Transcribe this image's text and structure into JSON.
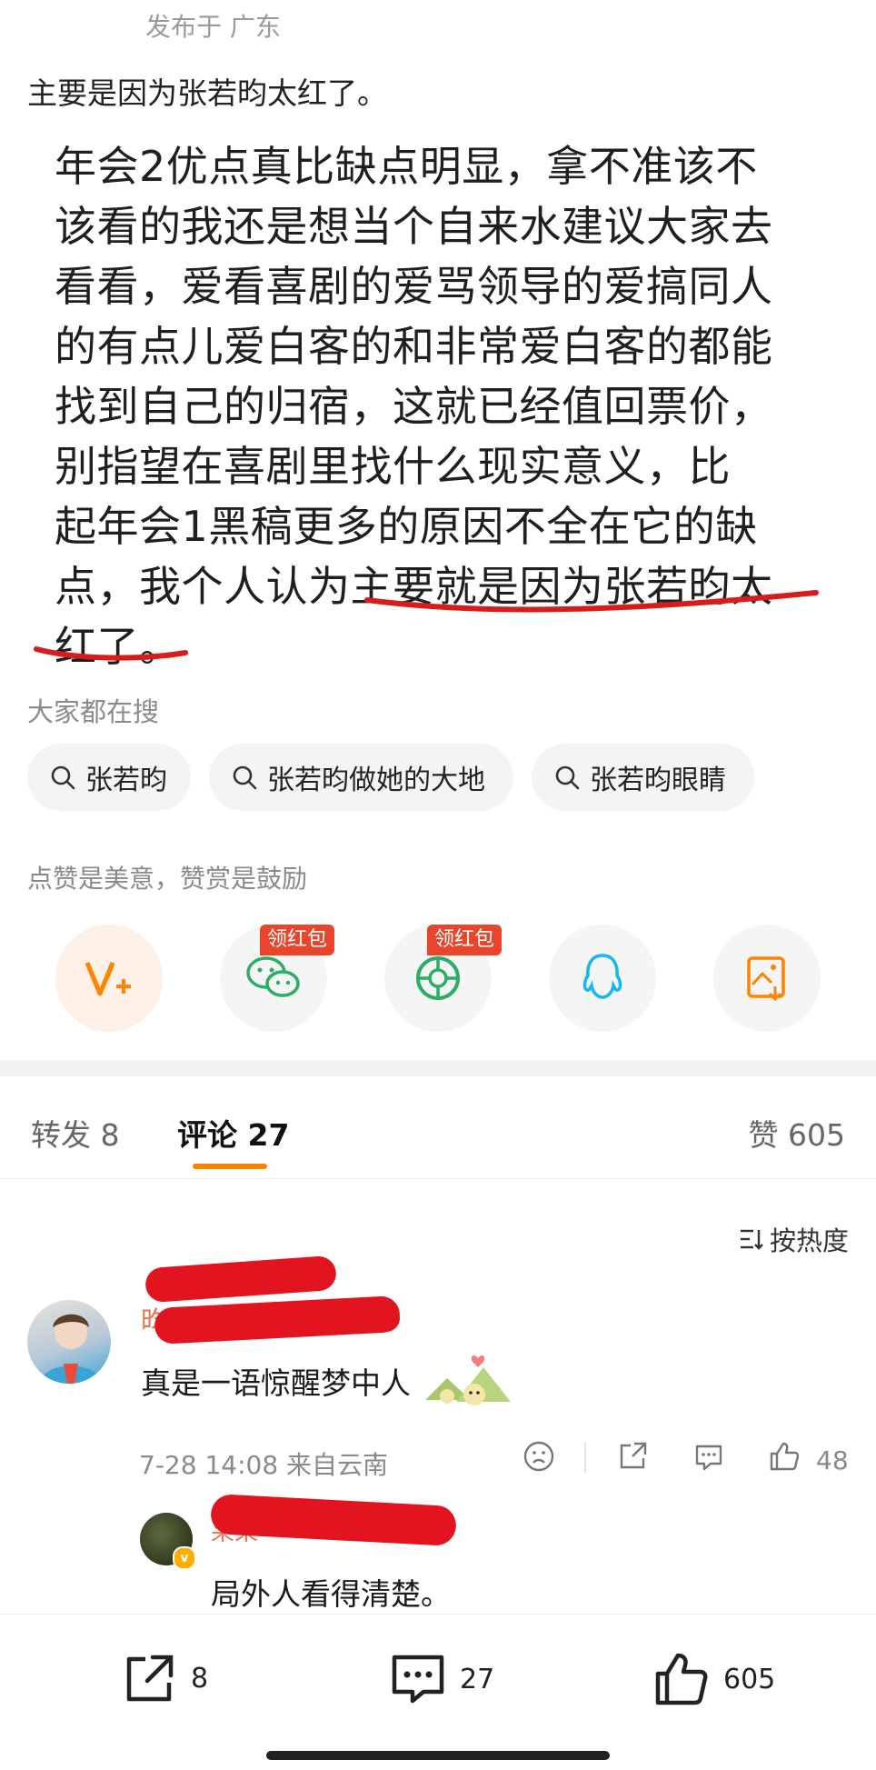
{
  "post": {
    "location_line": "发布于 广东",
    "text": "主要是因为张若昀太红了。"
  },
  "quote_image": {
    "lines": [
      "年会2优点真比缺点明显，拿不准该不",
      "该看的我还是想当个自来水建议大家去",
      "看看，爱看喜剧的爱骂领导的爱搞同人",
      "的有点儿爱白客的和非常爱白客的都能",
      "找到自己的归宿，这就已经值回票价，",
      "别指望在喜剧里找什么现实意义，比",
      "起年会1黑稿更多的原因不全在它的缺",
      "点，我个人认为主要就是因为张若昀太",
      "红了。"
    ]
  },
  "search": {
    "title": "大家都在搜",
    "chips": [
      "张若昀",
      "张若昀做她的大地",
      "张若昀眼睛"
    ]
  },
  "reward": {
    "hint": "点赞是美意，赞赏是鼓励",
    "badge_label": "领红包",
    "icons": [
      "v-plus-icon",
      "wechat-icon",
      "moments-icon",
      "qq-icon",
      "save-image-icon"
    ],
    "accent": "#ff8200"
  },
  "tabs": {
    "repost": "转发 8",
    "comments": "评论 27",
    "likes": "赞 605"
  },
  "sort_label": "按热度",
  "comments": [
    {
      "name_visible": "昀汐",
      "text": "真是一语惊醒梦中人",
      "time_location": "7-28 14:08 来自云南",
      "likes": "48",
      "reply": {
        "name_visible": "呆呆",
        "text": "局外人看得清楚。"
      }
    }
  ],
  "bottom_bar": {
    "repost_count": "8",
    "comment_count": "27",
    "like_count": "605"
  },
  "colors": {
    "redaction": "#e2141f",
    "username": "#eb7350",
    "badge": "#e8452c"
  }
}
